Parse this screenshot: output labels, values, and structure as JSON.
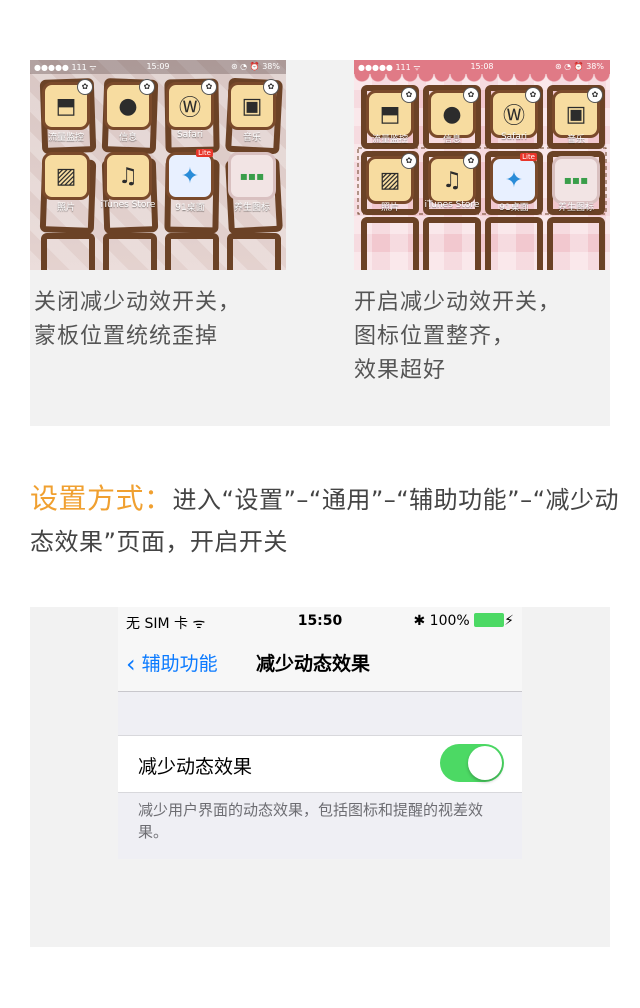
{
  "top_card": {
    "left_phone": {
      "status": {
        "carrier": "●●●●● 111 ᯤ",
        "time": "15:09",
        "right": "⊛ ◔ ⏰ 38%"
      },
      "apps": [
        {
          "label": "流量监控",
          "icon": "tray-icon"
        },
        {
          "label": "信息",
          "icon": "speech-bubble-icon"
        },
        {
          "label": "Safari",
          "icon": "wordpress-icon"
        },
        {
          "label": "音乐",
          "icon": "ipod-icon"
        },
        {
          "label": "照片",
          "icon": "photo-icon"
        },
        {
          "label": "iTunes Store",
          "icon": "music-note-icon"
        },
        {
          "label": "91桌面",
          "icon": "pinwheel-icon",
          "badge": "Lite"
        },
        {
          "label": "养生图标",
          "icon": "folder-icon"
        }
      ]
    },
    "right_phone": {
      "status": {
        "carrier": "●●●●● 111 ᯤ",
        "time": "15:08",
        "right": "⊛ ◔ ⏰ 38%"
      },
      "apps": [
        {
          "label": "流量监控",
          "icon": "tray-icon"
        },
        {
          "label": "信息",
          "icon": "speech-bubble-icon"
        },
        {
          "label": "Safari",
          "icon": "wordpress-icon"
        },
        {
          "label": "音乐",
          "icon": "ipod-icon"
        },
        {
          "label": "照片",
          "icon": "photo-icon"
        },
        {
          "label": "iTunes Store",
          "icon": "music-note-icon"
        },
        {
          "label": "91桌面",
          "icon": "pinwheel-icon",
          "badge": "Lite"
        },
        {
          "label": "养生图标",
          "icon": "folder-icon"
        }
      ]
    },
    "caption_left_line1": "关闭减少动效开关，",
    "caption_left_line2": "蒙板位置统统歪掉",
    "caption_right_line1": "开启减少动效开关，",
    "caption_right_line2": "图标位置整齐，",
    "caption_right_line3": "效果超好"
  },
  "instruction": {
    "highlight": "设置方式：",
    "text": "进入“设置”–“通用”–“辅助功能”–“减少动态效果”页面，开启开关",
    "highlight_color": "#f0a030"
  },
  "ios_screen": {
    "status": {
      "carrier": "无 SIM 卡 ᯤ",
      "time": "15:50",
      "bluetooth": "✱",
      "battery": "100%"
    },
    "back_label": "辅助功能",
    "title": "减少动态效果",
    "row_label": "减少动态效果",
    "toggle_on": true,
    "footnote": "减少用户界面的动态效果，包括图标和提醒的视差效果。",
    "accent_color": "#0a7aff",
    "toggle_color": "#4cd964"
  }
}
